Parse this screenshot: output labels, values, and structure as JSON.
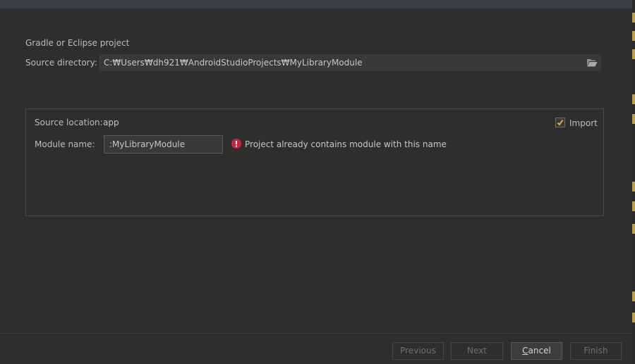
{
  "section": {
    "title": "Gradle or Eclipse project"
  },
  "source_directory": {
    "label": "Source directory:",
    "value": "C:₩Users₩dh921₩AndroidStudioProjects₩MyLibraryModule",
    "browse_icon": "folder-open-icon"
  },
  "module": {
    "source_location_label": "Source location:",
    "source_location_value": "app",
    "import_label": "Import",
    "import_checked": true,
    "module_name_label": "Module name:",
    "module_name_value": ":MyLibraryModule",
    "error_icon": "error-icon",
    "error_text": "Project already contains module with this name"
  },
  "buttons": {
    "previous": "Previous",
    "next": "Next",
    "cancel_mnemonic": "C",
    "cancel_rest": "ancel",
    "finish": "Finish"
  },
  "colors": {
    "error": "#c9243f",
    "check": "#e8a83b",
    "background": "#2f2e2c"
  }
}
